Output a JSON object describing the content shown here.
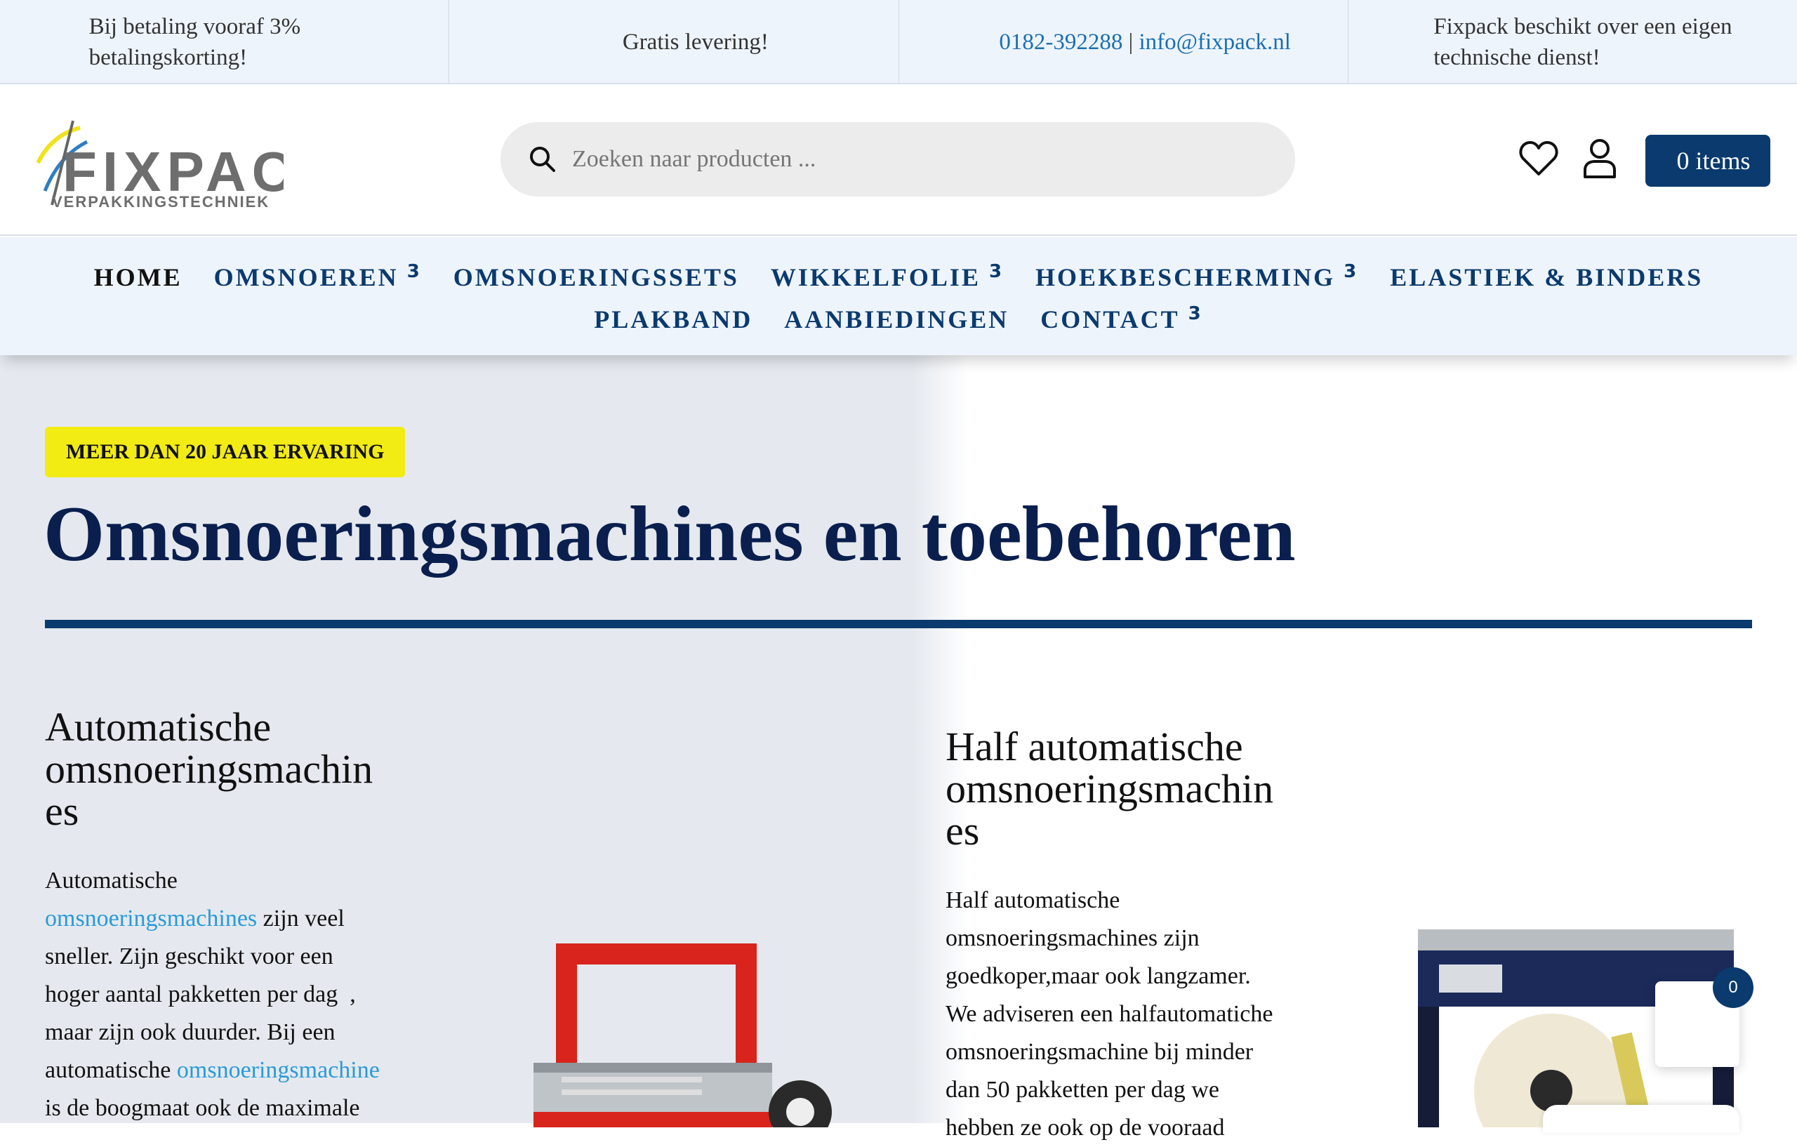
{
  "topbar": {
    "items": [
      {
        "icon": "percent-icon",
        "glyph": "",
        "text": "Bij betaling vooraf 3% betalingskorting!"
      },
      {
        "icon": "truck-icon",
        "glyph": "",
        "text": "Gratis levering!"
      },
      {
        "icon": "phone-icon",
        "glyph": "",
        "phone": "0182-392288",
        "separator": "|",
        "email": "info@fixpack.nl"
      },
      {
        "icon": "wrench-icon",
        "glyph": "",
        "text": "Fixpack beschikt over een eigen technische dienst!"
      }
    ]
  },
  "header": {
    "logo_main": "FIXPACK",
    "logo_sub": "VERPAKKINGSTECHNIEK",
    "search_placeholder": "Zoeken naar producten ...",
    "cart_glyph": "",
    "cart_label": "0 items"
  },
  "nav": {
    "row1": [
      {
        "label": "HOME",
        "arrow": ""
      },
      {
        "label": "OMSNOEREN",
        "arrow": "3"
      },
      {
        "label": "OMSNOERINGSSETS",
        "arrow": ""
      },
      {
        "label": "WIKKELFOLIE",
        "arrow": "3"
      },
      {
        "label": "HOEKBESCHERMING",
        "arrow": "3"
      },
      {
        "label": "ELASTIEK & BINDERS",
        "arrow": ""
      }
    ],
    "row2": [
      {
        "label": "PLAKBAND",
        "arrow": ""
      },
      {
        "label": "AANBIEDINGEN",
        "arrow": ""
      },
      {
        "label": "CONTACT",
        "arrow": "3"
      }
    ]
  },
  "hero": {
    "badge": "MEER DAN 20 JAAR ERVARING",
    "title": "Omsnoeringsmachines en toebehoren"
  },
  "col1": {
    "title_l1": "Automatische",
    "title_l2": "omsnoeringsmachin",
    "title_l3": "es",
    "t1": "Automatische",
    "t2_link": "omsnoeringsmachines",
    "t2_rest": " zijn veel",
    "t3": "sneller. Zijn geschikt voor een",
    "t4": "hoger aantal pakketten per dag  ,",
    "t5": "maar zijn ook duurder. Bij een",
    "t6_pre": "automatische ",
    "t6_link": "omsnoeringsmachine",
    "t7": "is de boogmaat ook de maximale"
  },
  "col2": {
    "title_l1": "Half automatische",
    "title_l2": "omsnoeringsmachin",
    "title_l3": "es",
    "t1": "Half automatische",
    "t2": "omsnoeringsmachines zijn",
    "t3": "goedkoper,maar ook langzamer.",
    "t4": "We adviseren een halfautomatiche",
    "t5": "omsnoeringsmachine bij minder",
    "t6": "dan 50 pakketten per dag we",
    "t7": "hebben ze ook op de vooraad"
  },
  "floating": {
    "glyph": "",
    "count": "0"
  }
}
